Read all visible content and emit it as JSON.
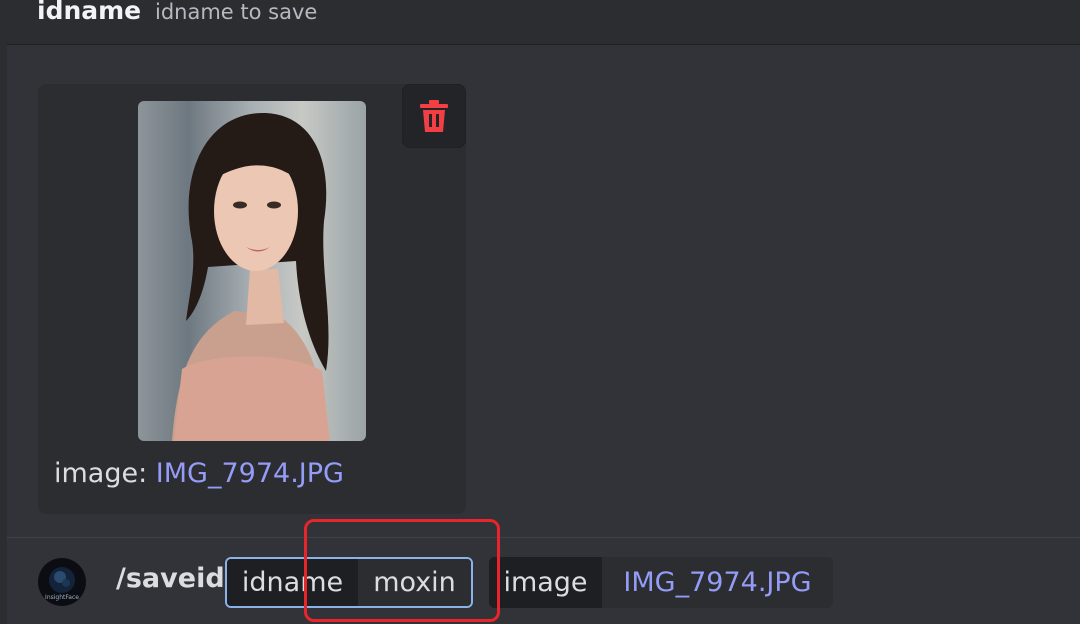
{
  "header": {
    "option_name": "idname",
    "option_description": "idname to save"
  },
  "attachment": {
    "caption_key": "image:",
    "caption_filename": "IMG_7974.JPG",
    "delete_icon": "trash-icon"
  },
  "command_bar": {
    "command": "/saveid",
    "avatar_label": "InsightFace",
    "options": [
      {
        "name": "idname",
        "value": "moxin"
      },
      {
        "name": "image",
        "value": "IMG_7974.JPG"
      }
    ]
  },
  "colors": {
    "background": "#313338",
    "secondary_background": "#2b2d31",
    "link": "#949cf7",
    "delete_red": "#f23f43",
    "focus_border": "#8ab4e8",
    "annotation_red": "#e8252a"
  }
}
